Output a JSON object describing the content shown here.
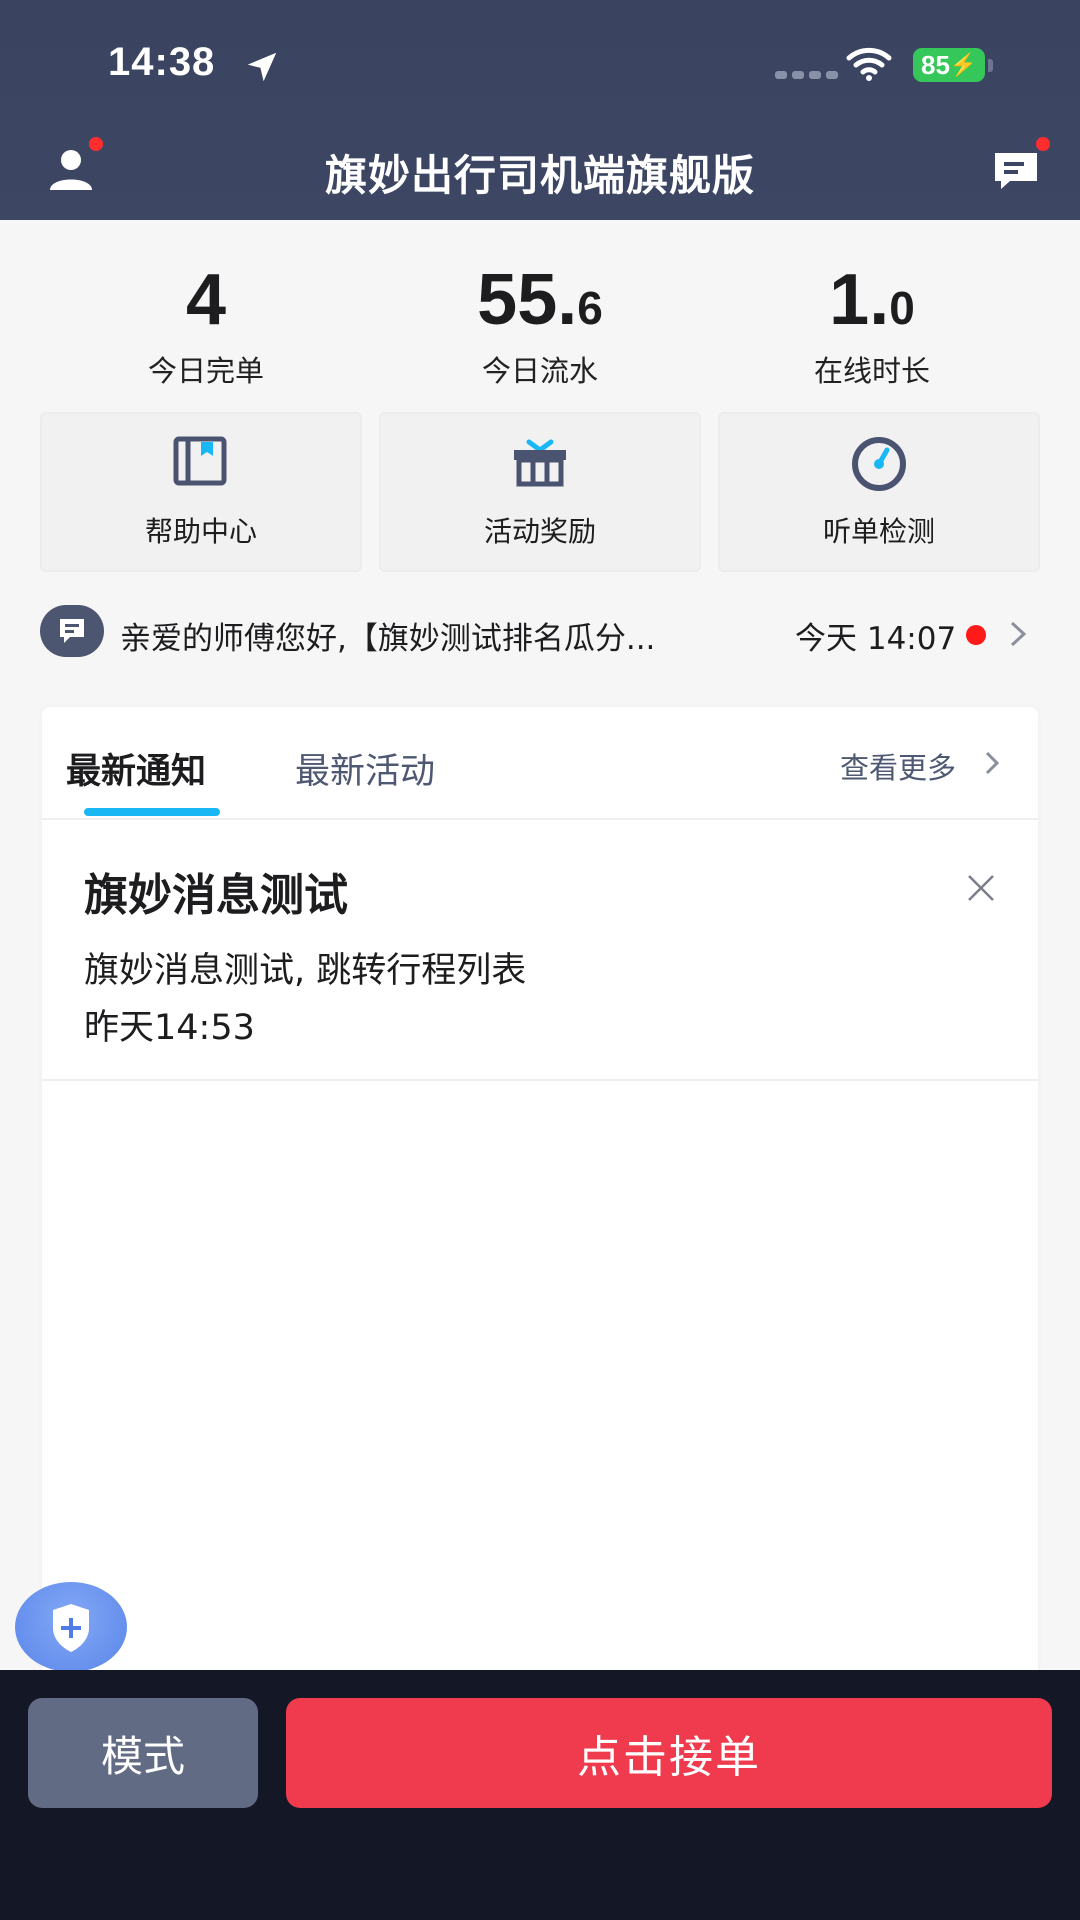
{
  "status_bar": {
    "time": "14:38",
    "battery": "85",
    "icons": [
      "location-arrow-icon",
      "signal-icon",
      "wifi-icon",
      "battery-icon"
    ]
  },
  "header": {
    "title": "旗妙出行司机端旗舰版",
    "left_icon": "user-icon",
    "right_icon": "message-icon"
  },
  "stats": [
    {
      "value_int": "4",
      "value_dec": "",
      "label": "今日完单"
    },
    {
      "value_int": "55.",
      "value_dec": "6",
      "label": "今日流水"
    },
    {
      "value_int": "1.",
      "value_dec": "0",
      "label": "在线时长"
    }
  ],
  "quick_actions": [
    {
      "label": "帮助中心",
      "icon": "book-icon"
    },
    {
      "label": "活动奖励",
      "icon": "gift-icon"
    },
    {
      "label": "听单检测",
      "icon": "gauge-icon"
    }
  ],
  "announcement": {
    "text": "亲爱的师傅您好,【旗妙测试排名瓜分...",
    "time": "今天 14:07",
    "icon": "chat-bubble-icon"
  },
  "tabs": {
    "active": "最新通知",
    "inactive": "最新活动",
    "more": "查看更多"
  },
  "notice": {
    "title": "旗妙消息测试",
    "body": "旗妙消息测试, 跳转行程列表",
    "time": "昨天14:53"
  },
  "bottom": {
    "mode_label": "模式",
    "accept_label": "点击接单"
  },
  "colors": {
    "header_bg": "#3a4460",
    "accent_blue": "#19b8f5",
    "accept_red": "#ef3b4d",
    "mode_gray": "#626b84",
    "bottom_bg": "#141726"
  }
}
